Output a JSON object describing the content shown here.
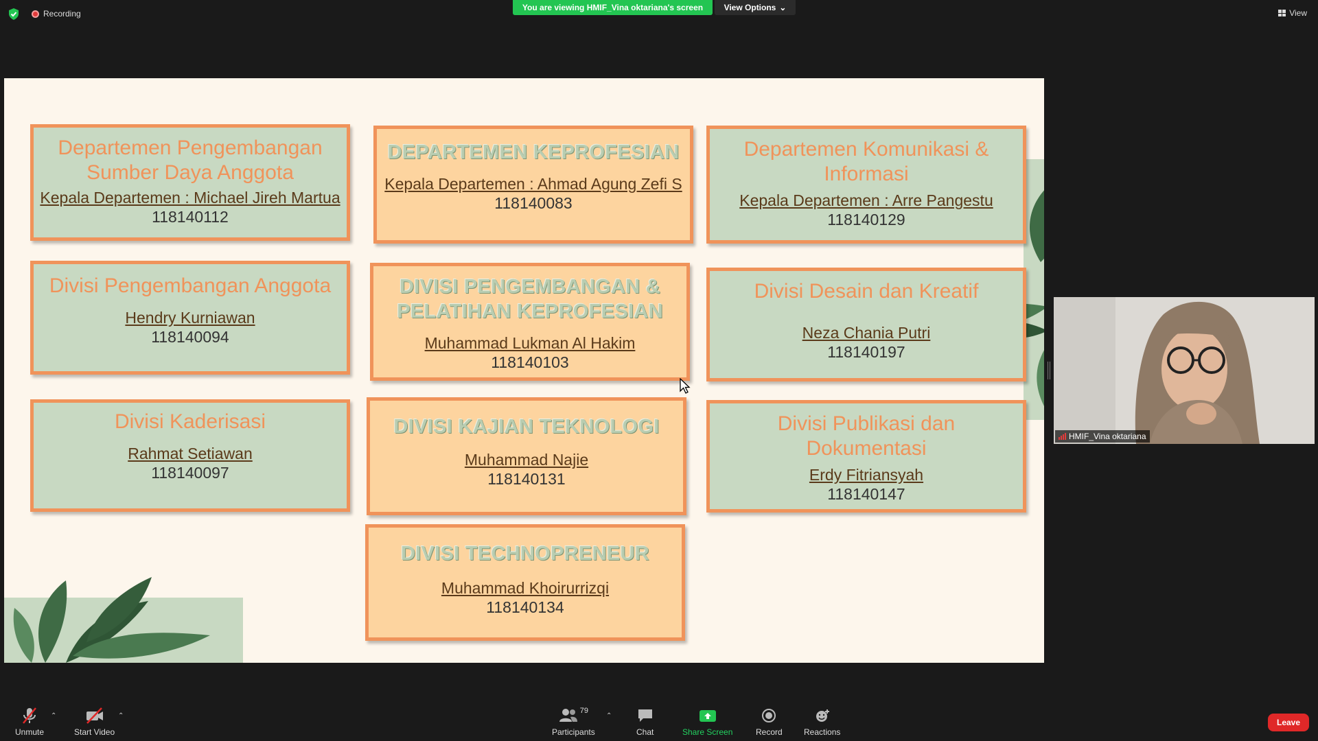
{
  "topbar": {
    "recording_label": "Recording",
    "viewing_banner": "You are viewing HMIF_Vina oktariana's screen",
    "view_options_label": "View Options",
    "view_label": "View"
  },
  "slide": {
    "cards": [
      {
        "title": "Departemen Pengembangan Sumber Daya Anggota",
        "head": "Kepala Departemen : Michael Jireh Martua",
        "id": "118140112"
      },
      {
        "title": "DEPARTEMEN KEPROFESIAN",
        "head": "Kepala Departemen : Ahmad  Agung  Zefi S",
        "id": "118140083"
      },
      {
        "title": "Departemen Komunikasi  & Informasi",
        "head": "Kepala Departemen : Arre Pangestu",
        "id": "118140129"
      },
      {
        "title": "Divisi Pengembangan Anggota",
        "head": "Hendry Kurniawan",
        "id": "118140094"
      },
      {
        "title": "DIVISI PENGEMBANGAN & PELATIHAN KEPROFESIAN",
        "head": "Muhammad  Lukman Al Hakim",
        "id": "118140103"
      },
      {
        "title": "Divisi Desain dan Kreatif",
        "head": "Neza  Chania Putri",
        "id": "118140197"
      },
      {
        "title": "Divisi Kaderisasi",
        "head": "Rahmat Setiawan",
        "id": "118140097"
      },
      {
        "title": "DIVISI KAJIAN TEKNOLOGI",
        "head": "Muhammad  Najie",
        "id": "118140131"
      },
      {
        "title": "Divisi Publikasi dan Dokumentasi",
        "head": "Erdy Fitriansyah",
        "id": "118140147"
      },
      {
        "title": "DIVISI TECHNOPRENEUR",
        "head": "Muhammad  Khoirurrizqi",
        "id": "118140134"
      }
    ]
  },
  "video": {
    "participant_name": "HMIF_Vina oktariana"
  },
  "toolbar": {
    "unmute": "Unmute",
    "start_video": "Start Video",
    "participants": "Participants",
    "participants_count": "79",
    "chat": "Chat",
    "share_screen": "Share Screen",
    "record": "Record",
    "reactions": "Reactions",
    "leave": "Leave"
  },
  "colors": {
    "share_green": "#23c552",
    "card_border": "#f0935a",
    "card_green": "#c8d9c2",
    "card_peach": "#fdd49f",
    "leave_red": "#e02828"
  }
}
